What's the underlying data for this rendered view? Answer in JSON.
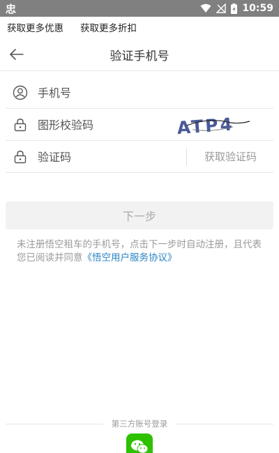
{
  "status_bar": {
    "app_icon": "忠",
    "time": "10:59"
  },
  "promo": {
    "item1": "获取更多优惠",
    "item2": "获取更多折扣"
  },
  "nav": {
    "title": "验证手机号"
  },
  "form": {
    "phone_placeholder": "手机号",
    "captcha_placeholder": "图形校验码",
    "captcha_text": "ATP4",
    "code_placeholder": "验证码",
    "get_code_label": "获取验证码"
  },
  "next_button": "下一步",
  "agreement": {
    "text": "未注册悟空租车的手机号，点击下一步时自动注册，且代表您已阅读并同意",
    "link": "《悟空用户服务协议》"
  },
  "third_party": {
    "label": "第三方账号登录",
    "wechat_icon": "wechat-icon"
  },
  "colors": {
    "status_bar": "#808080",
    "link": "#2b84c4",
    "wechat": "#2dc100",
    "button_disabled_bg": "#f2f2f2"
  }
}
